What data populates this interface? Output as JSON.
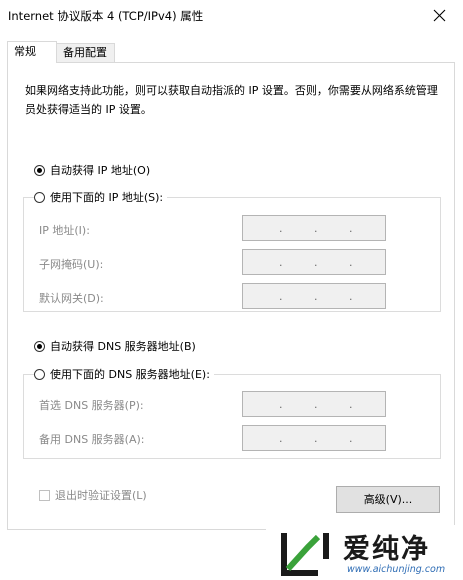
{
  "window": {
    "title": "Internet 协议版本 4 (TCP/IPv4) 属性"
  },
  "tabs": [
    {
      "label": "常规",
      "active": true
    },
    {
      "label": "备用配置",
      "active": false
    }
  ],
  "description": "如果网络支持此功能，则可以获取自动指派的 IP 设置。否则，你需要从网络系统管理员处获得适当的 IP 设置。",
  "ip": {
    "auto_label": "自动获得 IP 地址(O)",
    "auto_selected": true,
    "manual_label": "使用下面的 IP 地址(S):",
    "fields": [
      {
        "label": "IP 地址(I):",
        "value": ". . ."
      },
      {
        "label": "子网掩码(U):",
        "value": ". . ."
      },
      {
        "label": "默认网关(D):",
        "value": ". . ."
      }
    ]
  },
  "dns": {
    "auto_label": "自动获得 DNS 服务器地址(B)",
    "auto_selected": true,
    "manual_label": "使用下面的 DNS 服务器地址(E):",
    "fields": [
      {
        "label": "首选 DNS 服务器(P):",
        "value": ". . ."
      },
      {
        "label": "备用 DNS 服务器(A):",
        "value": ". . ."
      }
    ]
  },
  "validate_label": "退出时验证设置(L)",
  "validate_checked": false,
  "advanced_label": "高级(V)...",
  "watermark": {
    "brand": "爱纯净",
    "url": "www.aichunjing.com"
  },
  "icons": {
    "close": "close-icon",
    "logo": "watermark-logo-icon"
  },
  "colors": {
    "panel_border": "#d9d9d9",
    "disabled_text": "#8a8a8a",
    "button_bg": "#e1e1e1",
    "url_blue": "#2f6db5",
    "logo_green": "#3aa23a"
  }
}
